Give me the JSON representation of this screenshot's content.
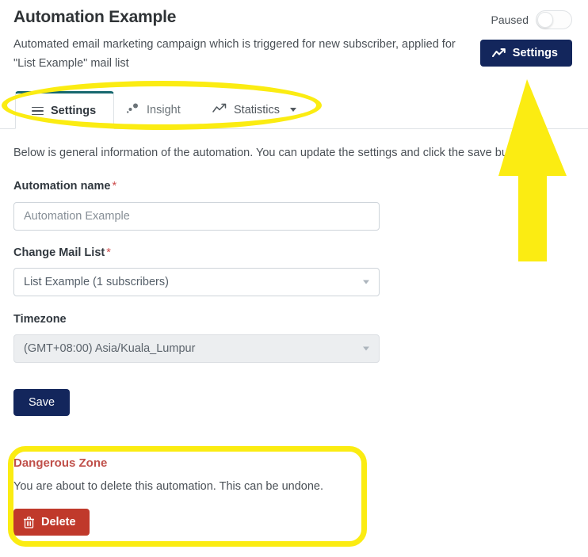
{
  "header": {
    "title": "Automation Example",
    "description": "Automated email marketing campaign which is triggered for new subscriber, applied for \"List Example\" mail list",
    "paused_label": "Paused",
    "paused_state": "off",
    "settings_button_label": "Settings",
    "settings_button_icon": "chart-line-icon",
    "settings_button_color": "#13265c"
  },
  "tabs": [
    {
      "label": "Settings",
      "icon": "hamburger-icon",
      "active": true
    },
    {
      "label": "Insight",
      "icon": "scatter-chart-icon",
      "active": false
    },
    {
      "label": "Statistics",
      "icon": "chart-line-icon",
      "active": false,
      "has_dropdown": true
    }
  ],
  "main": {
    "intro_text": "Below is general information of the automation. You can update the settings and click the save button.",
    "fields": {
      "automation_name": {
        "label": "Automation name",
        "required_marker": "*",
        "value": "Automation Example",
        "placeholder": "Automation Example"
      },
      "change_mail_list": {
        "label": "Change Mail List",
        "required_marker": "*",
        "value": "List Example (1 subscribers)"
      },
      "timezone": {
        "label": "Timezone",
        "value": "(GMT+08:00) Asia/Kuala_Lumpur",
        "disabled": true
      }
    },
    "save_button_label": "Save"
  },
  "danger_zone": {
    "title": "Dangerous Zone",
    "message": "You are about to delete this automation. This can be undone.",
    "delete_button_label": "Delete",
    "delete_button_icon": "trash-icon",
    "delete_button_color": "#c0392b",
    "title_color": "#c0504a"
  },
  "annotations": {
    "highlight_color": "#fbec12",
    "ellipse_target": "tabs-bar",
    "rect_target": "dangerous-zone",
    "arrow_target": "settings-button",
    "arrow_direction": "up"
  }
}
